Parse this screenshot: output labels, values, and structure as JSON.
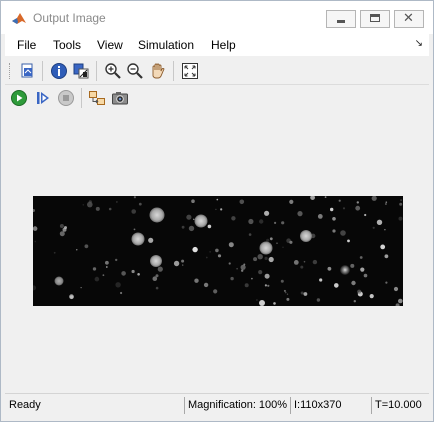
{
  "window": {
    "title": "Output Image",
    "minimize_icon": "minimize-icon",
    "maximize_icon": "maximize-icon",
    "close_icon": "close-icon"
  },
  "menu": {
    "items": [
      "File",
      "Tools",
      "View",
      "Simulation",
      "Help"
    ],
    "dock_icon": "dock-arrow-icon"
  },
  "toolbar1": {
    "icons": [
      "print-to-figure-icon",
      "info-icon",
      "adjust-contrast-icon",
      "zoom-in-icon",
      "zoom-out-icon",
      "pan-hand-icon",
      "fit-to-window-icon"
    ]
  },
  "toolbar2": {
    "icons": [
      "run-icon",
      "step-forward-icon",
      "stop-icon",
      "highlight-block-icon",
      "snapshot-camera-icon"
    ]
  },
  "colors": {
    "run_green": "#2e9b3a",
    "step_blue": "#3a66c4",
    "image_background": "#070707"
  },
  "status": {
    "ready": "Ready",
    "magnification": "Magnification: 100%",
    "image_size": "I:110x370",
    "time": "T=10.000"
  }
}
